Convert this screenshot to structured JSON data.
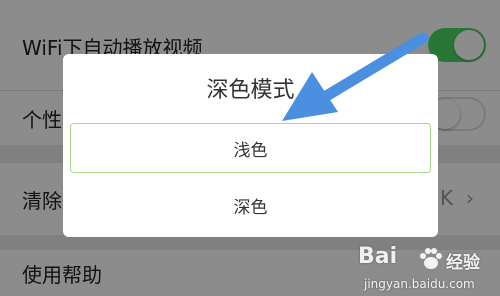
{
  "settings": {
    "wifi_autoplay_label": "WiFi下自动播放视频",
    "wifi_autoplay_on": true,
    "personalized_label": "个性",
    "personalized_on": false,
    "clear_cache_label": "清除",
    "cache_size": "K",
    "help_label": "使用帮助"
  },
  "dialog": {
    "title": "深色模式",
    "options": [
      {
        "label": "浅色",
        "selected": true
      },
      {
        "label": "深色",
        "selected": false
      }
    ]
  },
  "annotation": {
    "arrow_color": "#4a8fe0"
  },
  "watermark": {
    "brand": "Bai",
    "jingyan": "经验",
    "url": "jingyan.baidu.com"
  },
  "colors": {
    "toggle_on": "#4cd964",
    "selected_border": "#a9d98b"
  }
}
